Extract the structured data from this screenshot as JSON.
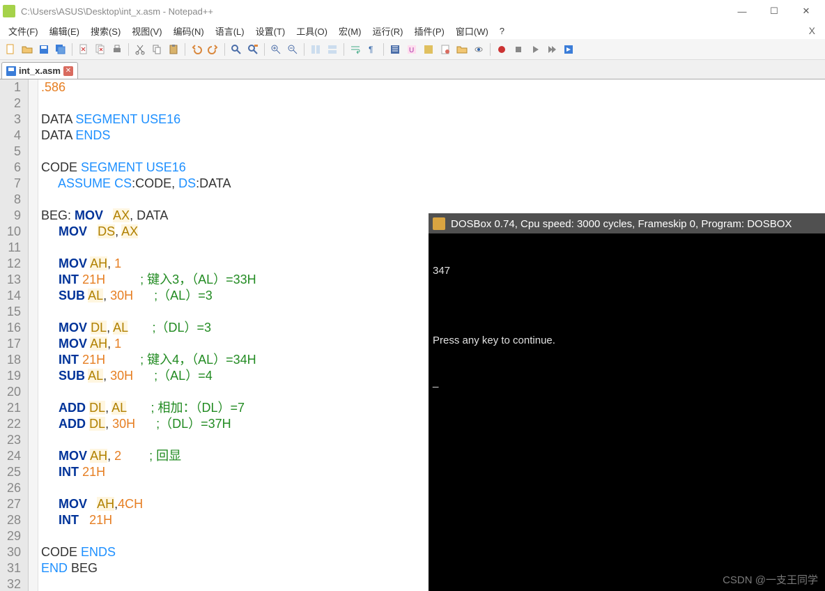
{
  "window": {
    "title": "C:\\Users\\ASUS\\Desktop\\int_x.asm - Notepad++"
  },
  "menus": {
    "file": "文件(F)",
    "edit": "编辑(E)",
    "search": "搜索(S)",
    "view": "视图(V)",
    "encoding": "编码(N)",
    "language": "语言(L)",
    "settings": "设置(T)",
    "tools": "工具(O)",
    "macro": "宏(M)",
    "run": "运行(R)",
    "plugins": "插件(P)",
    "window": "窗口(W)",
    "help": "?",
    "closeX": "X"
  },
  "tab": {
    "label": "int_x.asm"
  },
  "code": [
    {
      "n": 1,
      "segs": [
        {
          "c": "dir",
          "t": ".586"
        }
      ]
    },
    {
      "n": 2,
      "segs": []
    },
    {
      "n": 3,
      "segs": [
        {
          "c": "txt",
          "t": "DATA "
        },
        {
          "c": "kw2",
          "t": "SEGMENT"
        },
        {
          "c": "txt",
          "t": " "
        },
        {
          "c": "kw2",
          "t": "USE16"
        }
      ]
    },
    {
      "n": 4,
      "segs": [
        {
          "c": "txt",
          "t": "DATA "
        },
        {
          "c": "kw2",
          "t": "ENDS"
        }
      ]
    },
    {
      "n": 5,
      "segs": []
    },
    {
      "n": 6,
      "segs": [
        {
          "c": "txt",
          "t": "CODE "
        },
        {
          "c": "kw2",
          "t": "SEGMENT"
        },
        {
          "c": "txt",
          "t": " "
        },
        {
          "c": "kw2",
          "t": "USE16"
        }
      ]
    },
    {
      "n": 7,
      "segs": [
        {
          "c": "txt",
          "t": "     "
        },
        {
          "c": "kw2",
          "t": "ASSUME"
        },
        {
          "c": "txt",
          "t": " "
        },
        {
          "c": "kw2",
          "t": "CS"
        },
        {
          "c": "txt",
          "t": ":CODE, "
        },
        {
          "c": "kw2",
          "t": "DS"
        },
        {
          "c": "txt",
          "t": ":DATA"
        }
      ]
    },
    {
      "n": 8,
      "segs": []
    },
    {
      "n": 9,
      "segs": [
        {
          "c": "txt",
          "t": "BEG: "
        },
        {
          "c": "kw",
          "t": "MOV"
        },
        {
          "c": "txt",
          "t": "   "
        },
        {
          "c": "reg",
          "t": "AX"
        },
        {
          "c": "txt",
          "t": ", DATA"
        }
      ]
    },
    {
      "n": 10,
      "segs": [
        {
          "c": "txt",
          "t": "     "
        },
        {
          "c": "kw",
          "t": "MOV"
        },
        {
          "c": "txt",
          "t": "   "
        },
        {
          "c": "reg",
          "t": "DS"
        },
        {
          "c": "txt",
          "t": ", "
        },
        {
          "c": "reg",
          "t": "AX"
        }
      ]
    },
    {
      "n": 11,
      "segs": []
    },
    {
      "n": 12,
      "segs": [
        {
          "c": "txt",
          "t": "     "
        },
        {
          "c": "kw",
          "t": "MOV"
        },
        {
          "c": "txt",
          "t": " "
        },
        {
          "c": "reg",
          "t": "AH"
        },
        {
          "c": "txt",
          "t": ", "
        },
        {
          "c": "num",
          "t": "1"
        }
      ]
    },
    {
      "n": 13,
      "segs": [
        {
          "c": "txt",
          "t": "     "
        },
        {
          "c": "kw",
          "t": "INT"
        },
        {
          "c": "txt",
          "t": " "
        },
        {
          "c": "num",
          "t": "21H"
        },
        {
          "c": "txt",
          "t": "          "
        },
        {
          "c": "com",
          "t": "; 键入3，（AL）=33H"
        }
      ]
    },
    {
      "n": 14,
      "segs": [
        {
          "c": "txt",
          "t": "     "
        },
        {
          "c": "kw",
          "t": "SUB"
        },
        {
          "c": "txt",
          "t": " "
        },
        {
          "c": "reg",
          "t": "AL"
        },
        {
          "c": "txt",
          "t": ", "
        },
        {
          "c": "num",
          "t": "30H"
        },
        {
          "c": "txt",
          "t": "      "
        },
        {
          "c": "com",
          "t": ";（AL）=3"
        }
      ]
    },
    {
      "n": 15,
      "segs": []
    },
    {
      "n": 16,
      "segs": [
        {
          "c": "txt",
          "t": "     "
        },
        {
          "c": "kw",
          "t": "MOV"
        },
        {
          "c": "txt",
          "t": " "
        },
        {
          "c": "reg",
          "t": "DL"
        },
        {
          "c": "txt",
          "t": ", "
        },
        {
          "c": "reg",
          "t": "AL"
        },
        {
          "c": "txt",
          "t": "       "
        },
        {
          "c": "com",
          "t": ";（DL）=3"
        }
      ]
    },
    {
      "n": 17,
      "segs": [
        {
          "c": "txt",
          "t": "     "
        },
        {
          "c": "kw",
          "t": "MOV"
        },
        {
          "c": "txt",
          "t": " "
        },
        {
          "c": "reg",
          "t": "AH"
        },
        {
          "c": "txt",
          "t": ", "
        },
        {
          "c": "num",
          "t": "1"
        }
      ]
    },
    {
      "n": 18,
      "segs": [
        {
          "c": "txt",
          "t": "     "
        },
        {
          "c": "kw",
          "t": "INT"
        },
        {
          "c": "txt",
          "t": " "
        },
        {
          "c": "num",
          "t": "21H"
        },
        {
          "c": "txt",
          "t": "          "
        },
        {
          "c": "com",
          "t": "; 键入4，（AL）=34H"
        }
      ]
    },
    {
      "n": 19,
      "segs": [
        {
          "c": "txt",
          "t": "     "
        },
        {
          "c": "kw",
          "t": "SUB"
        },
        {
          "c": "txt",
          "t": " "
        },
        {
          "c": "reg",
          "t": "AL"
        },
        {
          "c": "txt",
          "t": ", "
        },
        {
          "c": "num",
          "t": "30H"
        },
        {
          "c": "txt",
          "t": "      "
        },
        {
          "c": "com",
          "t": ";（AL）=4"
        }
      ]
    },
    {
      "n": 20,
      "segs": []
    },
    {
      "n": 21,
      "segs": [
        {
          "c": "txt",
          "t": "     "
        },
        {
          "c": "kw",
          "t": "ADD"
        },
        {
          "c": "txt",
          "t": " "
        },
        {
          "c": "reg",
          "t": "DL"
        },
        {
          "c": "txt",
          "t": ", "
        },
        {
          "c": "reg",
          "t": "AL"
        },
        {
          "c": "txt",
          "t": "       "
        },
        {
          "c": "com",
          "t": "; 相加：（DL）=7"
        }
      ]
    },
    {
      "n": 22,
      "segs": [
        {
          "c": "txt",
          "t": "     "
        },
        {
          "c": "kw",
          "t": "ADD"
        },
        {
          "c": "txt",
          "t": " "
        },
        {
          "c": "reg",
          "t": "DL"
        },
        {
          "c": "txt",
          "t": ", "
        },
        {
          "c": "num",
          "t": "30H"
        },
        {
          "c": "txt",
          "t": "      "
        },
        {
          "c": "com",
          "t": ";（DL）=37H"
        }
      ]
    },
    {
      "n": 23,
      "segs": []
    },
    {
      "n": 24,
      "segs": [
        {
          "c": "txt",
          "t": "     "
        },
        {
          "c": "kw",
          "t": "MOV"
        },
        {
          "c": "txt",
          "t": " "
        },
        {
          "c": "reg",
          "t": "AH"
        },
        {
          "c": "txt",
          "t": ", "
        },
        {
          "c": "num",
          "t": "2"
        },
        {
          "c": "txt",
          "t": "        "
        },
        {
          "c": "com",
          "t": "; 回显"
        }
      ]
    },
    {
      "n": 25,
      "segs": [
        {
          "c": "txt",
          "t": "     "
        },
        {
          "c": "kw",
          "t": "INT"
        },
        {
          "c": "txt",
          "t": " "
        },
        {
          "c": "num",
          "t": "21H"
        }
      ]
    },
    {
      "n": 26,
      "segs": []
    },
    {
      "n": 27,
      "segs": [
        {
          "c": "txt",
          "t": "     "
        },
        {
          "c": "kw",
          "t": "MOV"
        },
        {
          "c": "txt",
          "t": "   "
        },
        {
          "c": "reg",
          "t": "AH"
        },
        {
          "c": "txt",
          "t": ","
        },
        {
          "c": "num",
          "t": "4CH"
        }
      ]
    },
    {
      "n": 28,
      "segs": [
        {
          "c": "txt",
          "t": "     "
        },
        {
          "c": "kw",
          "t": "INT"
        },
        {
          "c": "txt",
          "t": "   "
        },
        {
          "c": "num",
          "t": "21H"
        }
      ]
    },
    {
      "n": 29,
      "segs": []
    },
    {
      "n": 30,
      "segs": [
        {
          "c": "txt",
          "t": "CODE "
        },
        {
          "c": "kw2",
          "t": "ENDS"
        }
      ]
    },
    {
      "n": 31,
      "segs": [
        {
          "c": "kw2",
          "t": "END"
        },
        {
          "c": "txt",
          "t": " BEG"
        }
      ]
    },
    {
      "n": 32,
      "segs": []
    }
  ],
  "dosbox": {
    "title": "DOSBox 0.74, Cpu speed:    3000 cycles, Frameskip  0, Program:   DOSBOX",
    "out1": "347",
    "out2": "",
    "out3": "Press any key to continue.",
    "out4": "_"
  },
  "watermark": "CSDN @一支王同学"
}
